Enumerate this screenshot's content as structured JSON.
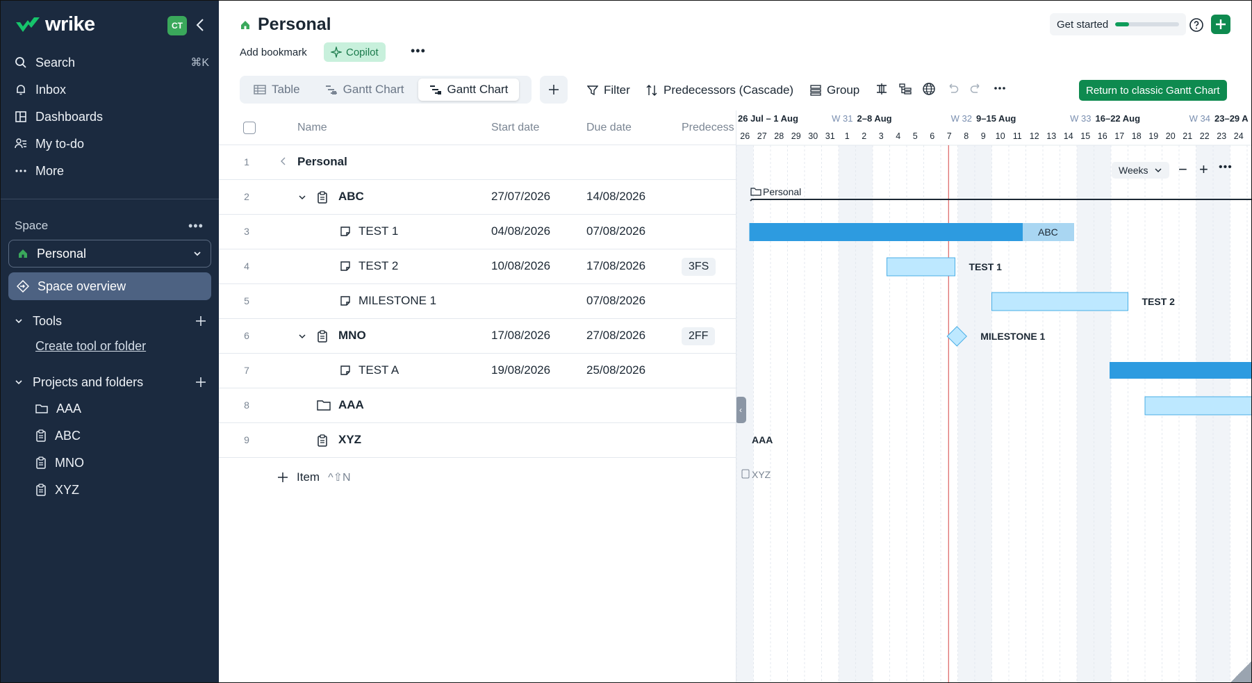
{
  "sidebar": {
    "brand": "wrike",
    "avatar_initials": "CT",
    "nav": [
      {
        "label": "Search",
        "shortcut": "⌘K",
        "icon": "search-icon"
      },
      {
        "label": "Inbox",
        "icon": "bell-icon"
      },
      {
        "label": "Dashboards",
        "icon": "dashboard-icon"
      },
      {
        "label": "My to-do",
        "icon": "todo-icon"
      },
      {
        "label": "More",
        "icon": "more-icon"
      }
    ],
    "space_label": "Space",
    "space_name": "Personal",
    "space_overview": "Space overview",
    "tools_label": "Tools",
    "create_tool": "Create tool or folder",
    "projects_label": "Projects and folders",
    "projects": [
      {
        "name": "AAA",
        "icon": "folder-icon"
      },
      {
        "name": "ABC",
        "icon": "project-icon"
      },
      {
        "name": "MNO",
        "icon": "project-icon"
      },
      {
        "name": "XYZ",
        "icon": "project-icon"
      }
    ]
  },
  "header": {
    "title": "Personal",
    "add_bookmark": "Add bookmark",
    "copilot": "Copilot",
    "get_started": "Get started",
    "get_started_progress": 0.22
  },
  "toolbar": {
    "tabs": [
      {
        "label": "Table",
        "active": false
      },
      {
        "label": "Gantt Chart",
        "active": false
      },
      {
        "label": "Gantt Chart",
        "active": true
      }
    ],
    "filter": "Filter",
    "predecessors": "Predecessors (Cascade)",
    "group": "Group",
    "return_classic": "Return to classic Gantt Chart"
  },
  "table": {
    "columns": [
      "Name",
      "Start date",
      "Due date",
      "Predecess"
    ],
    "rows": [
      {
        "num": "1",
        "name": "Personal",
        "start": "",
        "due": "",
        "pred": ""
      },
      {
        "num": "2",
        "name": "ABC",
        "start": "27/07/2026",
        "due": "14/08/2026",
        "pred": ""
      },
      {
        "num": "3",
        "name": "TEST 1",
        "start": "04/08/2026",
        "due": "07/08/2026",
        "pred": ""
      },
      {
        "num": "4",
        "name": "TEST 2",
        "start": "10/08/2026",
        "due": "17/08/2026",
        "pred": "3FS"
      },
      {
        "num": "5",
        "name": "MILESTONE 1",
        "start": "",
        "due": "07/08/2026",
        "pred": ""
      },
      {
        "num": "6",
        "name": "MNO",
        "start": "17/08/2026",
        "due": "27/08/2026",
        "pred": "2FF"
      },
      {
        "num": "7",
        "name": "TEST A",
        "start": "19/08/2026",
        "due": "25/08/2026",
        "pred": ""
      },
      {
        "num": "8",
        "name": "AAA",
        "start": "",
        "due": "",
        "pred": ""
      },
      {
        "num": "9",
        "name": "XYZ",
        "start": "",
        "due": "",
        "pred": ""
      }
    ],
    "add_item": "Item",
    "add_item_shortcut": "^⇧N"
  },
  "gantt": {
    "weeks": [
      {
        "range": "26 Jul – 1 Aug",
        "week": "W 31"
      },
      {
        "range": "2–8 Aug",
        "week": "W 32"
      },
      {
        "range": "9–15 Aug",
        "week": "W 33"
      },
      {
        "range": "16–22 Aug",
        "week": "W 34"
      },
      {
        "range": "23–29 A",
        "week": ""
      }
    ],
    "days": [
      "26",
      "27",
      "28",
      "29",
      "30",
      "31",
      "1",
      "2",
      "3",
      "4",
      "5",
      "6",
      "7",
      "8",
      "9",
      "10",
      "11",
      "12",
      "13",
      "14",
      "15",
      "16",
      "17",
      "18",
      "19",
      "20",
      "21",
      "22",
      "23",
      "24",
      "2"
    ],
    "scale": "Weeks",
    "labels": {
      "personal": "Personal",
      "abc": "ABC",
      "test1": "TEST 1",
      "test2": "TEST 2",
      "milestone": "MILESTONE 1",
      "aaa": "AAA",
      "xyz": "XYZ"
    },
    "colors": {
      "project_bar": "#2d9be0",
      "task_bar": "#bde8ff",
      "task_border": "#49aee6",
      "today": "#d64545"
    }
  }
}
